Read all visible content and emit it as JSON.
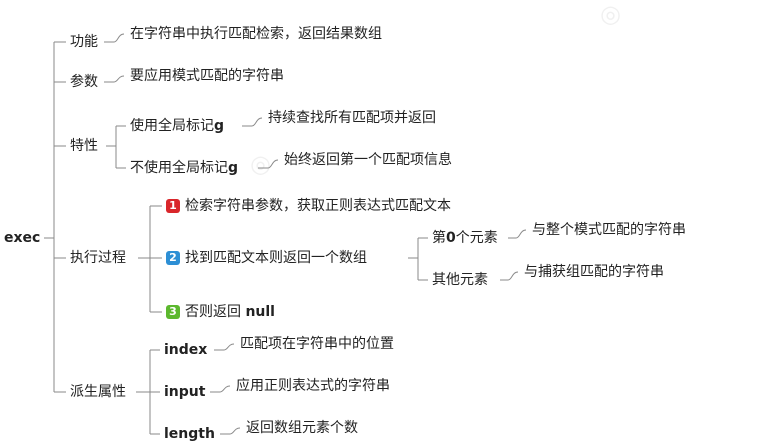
{
  "root": "exec",
  "branches": {
    "function": {
      "label": "功能",
      "desc": "在字符串中执行匹配检索，返回结果数组"
    },
    "params": {
      "label": "参数",
      "desc": "要应用模式匹配的字符串"
    },
    "features": {
      "label": "特性",
      "global_label": "使用全局标记",
      "global_flag": "g",
      "global_desc": "持续查找所有匹配项并返回",
      "nonglobal_label": "不使用全局标记",
      "nonglobal_flag": "g",
      "nonglobal_desc": "始终返回第一个匹配项信息"
    },
    "process": {
      "label": "执行过程",
      "step1_num": "1",
      "step1": "检索字符串参数，获取正则表达式匹配文本",
      "step2_num": "2",
      "step2": "找到匹配文本则返回一个数组",
      "first_prefix": "第",
      "first_num": "0",
      "first_suffix": "个元素",
      "first_desc": "与整个模式匹配的字符串",
      "other": "其他元素",
      "other_desc": "与捕获组匹配的字符串",
      "step3_num": "3",
      "step3_prefix": "否则返回",
      "step3_value": "null"
    },
    "derived": {
      "label": "派生属性",
      "index": "index",
      "index_desc": "匹配项在字符串中的位置",
      "input": "input",
      "input_desc": "应用正则表达式的字符串",
      "length": "length",
      "length_desc": "返回数组元素个数"
    }
  },
  "colors": {
    "line": "#8a8a8a",
    "badge1": "#d9262b",
    "badge2": "#2d8fd5",
    "badge3": "#5cb82e"
  }
}
